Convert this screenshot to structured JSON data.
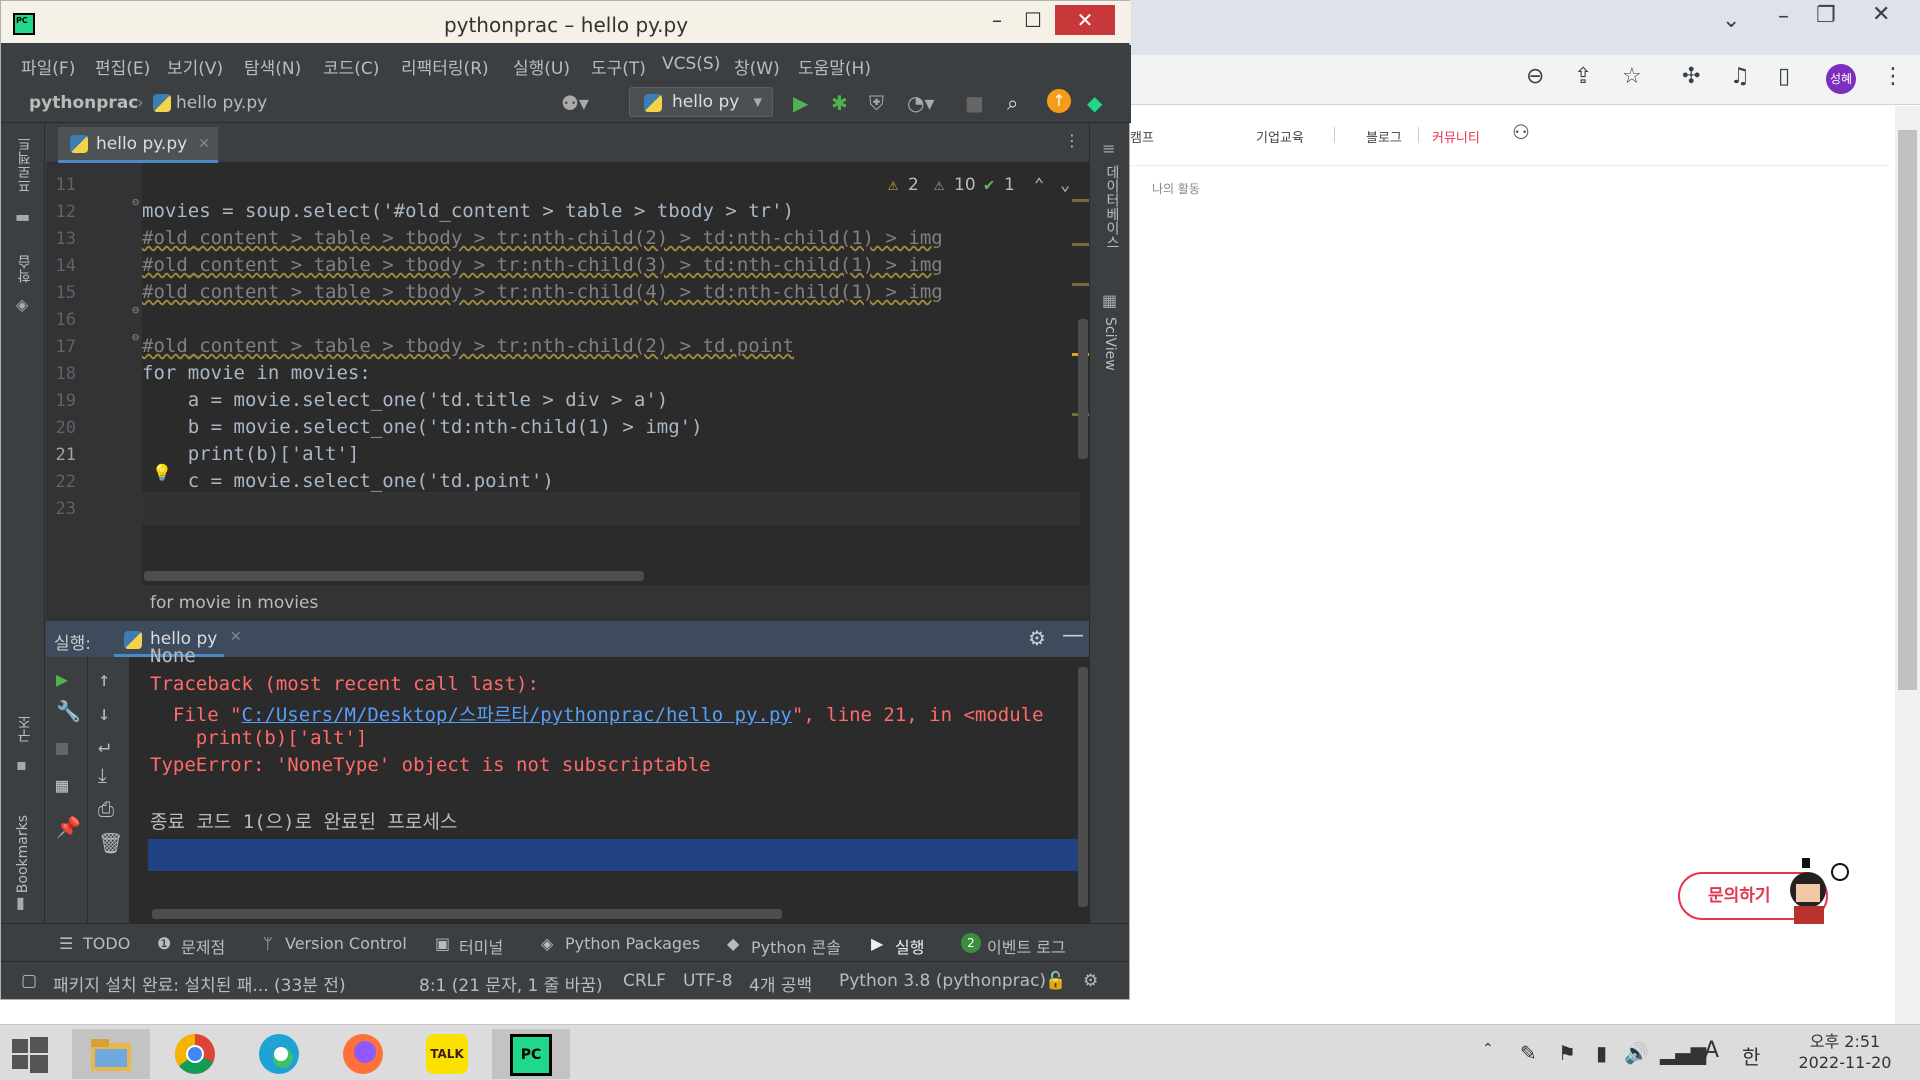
{
  "browser": {
    "nav": [
      "캠프",
      "기업교육",
      "블로그",
      "커뮤니티"
    ],
    "subnav": "나의 활동",
    "profile_initials": "성혜",
    "inquiry_button": "문의하기"
  },
  "pycharm": {
    "title": "pythonprac – hello py.py",
    "menu": [
      "파일(F)",
      "편집(E)",
      "보기(V)",
      "탐색(N)",
      "코드(C)",
      "리팩터링(R)",
      "실행(U)",
      "도구(T)",
      "VCS(S)",
      "창(W)",
      "도움말(H)"
    ],
    "breadcrumb": {
      "project": "pythonprac",
      "file": "hello py.py"
    },
    "run_config": "hello py",
    "editor_tab": "hello py.py",
    "left_tools": [
      "프로젝트",
      "학습",
      "구조",
      "Bookmarks"
    ],
    "right_tools": [
      "데이터베이스",
      "SciView"
    ],
    "inspections": {
      "warnings": "2",
      "weak_warnings": "10",
      "ok": "1"
    },
    "code_lines": [
      {
        "n": "11",
        "text": ""
      },
      {
        "n": "12",
        "text": "movies = soup.select('#old_content > table > tbody > tr')"
      },
      {
        "n": "13",
        "text": "#old_content > table > tbody > tr:nth-child(2) > td:nth-child(1) > img"
      },
      {
        "n": "14",
        "text": "#old_content > table > tbody > tr:nth-child(3) > td:nth-child(1) > img"
      },
      {
        "n": "15",
        "text": "#old_content > table > tbody > tr:nth-child(4) > td:nth-child(1) > img"
      },
      {
        "n": "16",
        "text": ""
      },
      {
        "n": "17",
        "text": "#old_content > table > tbody > tr:nth-child(2) > td.point"
      },
      {
        "n": "18",
        "text": "for movie in movies:"
      },
      {
        "n": "19",
        "text": "    a = movie.select_one('td.title > div > a')"
      },
      {
        "n": "20",
        "text": "    b = movie.select_one('td:nth-child(1) > img')"
      },
      {
        "n": "21",
        "text": "    print(b)['alt']"
      },
      {
        "n": "22",
        "text": "    c = movie.select_one('td.point')"
      },
      {
        "n": "23",
        "text": ""
      }
    ],
    "code_breadcrumb": "for movie in movies",
    "run_panel": {
      "label": "실행:",
      "tab": "hello py",
      "output": {
        "partial": "None",
        "traceback": "Traceback (most recent call last):",
        "file_prefix": "  File \"",
        "file_link": "C:/Users/M/Desktop/스파르타/pythonprac/hello py.py",
        "file_suffix": "\", line 21, in <module",
        "code": "    print(b)['alt']",
        "error": "TypeError: 'NoneType' object is not subscriptable",
        "exit": "종료 코드 1(으)로 완료된 프로세스"
      }
    },
    "tool_windows": [
      "TODO",
      "문제점",
      "Version Control",
      "터미널",
      "Python Packages",
      "Python 콘솔",
      "실행",
      "이벤트 로그"
    ],
    "event_count": "2",
    "status": {
      "message": "패키지 설치 완료: 설치된 패... (33분 전)",
      "position": "8:1 (21 문자, 1 줄 바꿈)",
      "line_sep": "CRLF",
      "encoding": "UTF-8",
      "indent": "4개 공백",
      "interpreter": "Python 3.8 (pythonprac)"
    }
  },
  "taskbar": {
    "apps": [
      "file-explorer",
      "chrome",
      "edge",
      "firefox",
      "kakaotalk",
      "pycharm"
    ],
    "kakao_label": "TALK",
    "pycharm_label": "PC",
    "ime": "A",
    "time": "오후 2:51",
    "date": "2022-11-20"
  }
}
